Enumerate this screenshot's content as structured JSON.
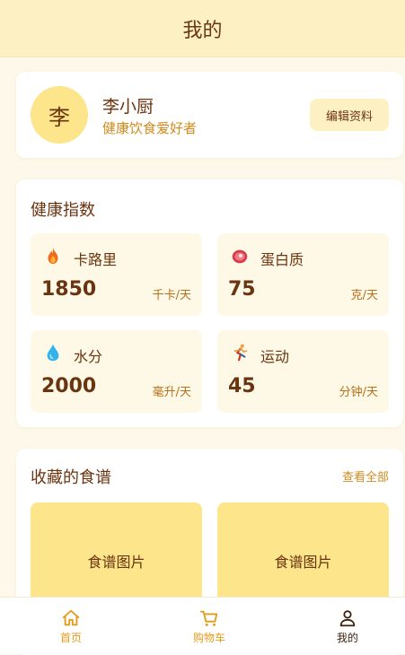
{
  "header": {
    "title": "我的"
  },
  "profile": {
    "avatar_text": "李",
    "name": "李小厨",
    "bio": "健康饮食爱好者",
    "edit_label": "编辑资料"
  },
  "health": {
    "title": "健康指数",
    "metrics": [
      {
        "icon": "flame-icon",
        "label": "卡路里",
        "value": "1850",
        "unit": "千卡/天"
      },
      {
        "icon": "meat-icon",
        "label": "蛋白质",
        "value": "75",
        "unit": "克/天"
      },
      {
        "icon": "water-drop-icon",
        "label": "水分",
        "value": "2000",
        "unit": "毫升/天"
      },
      {
        "icon": "runner-icon",
        "label": "运动",
        "value": "45",
        "unit": "分钟/天"
      }
    ]
  },
  "recipes": {
    "title": "收藏的食谱",
    "view_all": "查看全部",
    "items": [
      {
        "image_label": "食谱图片"
      },
      {
        "image_label": "食谱图片"
      }
    ]
  },
  "tabbar": {
    "items": [
      {
        "icon": "home-icon",
        "label": "首页",
        "active": false
      },
      {
        "icon": "cart-icon",
        "label": "购物车",
        "active": false
      },
      {
        "icon": "user-icon",
        "label": "我的",
        "active": true
      }
    ]
  },
  "colors": {
    "accent": "#e39b1b",
    "text_brown": "#6b3410",
    "avatar_bg": "#fce58a",
    "header_bg": "#fdf1c4"
  }
}
